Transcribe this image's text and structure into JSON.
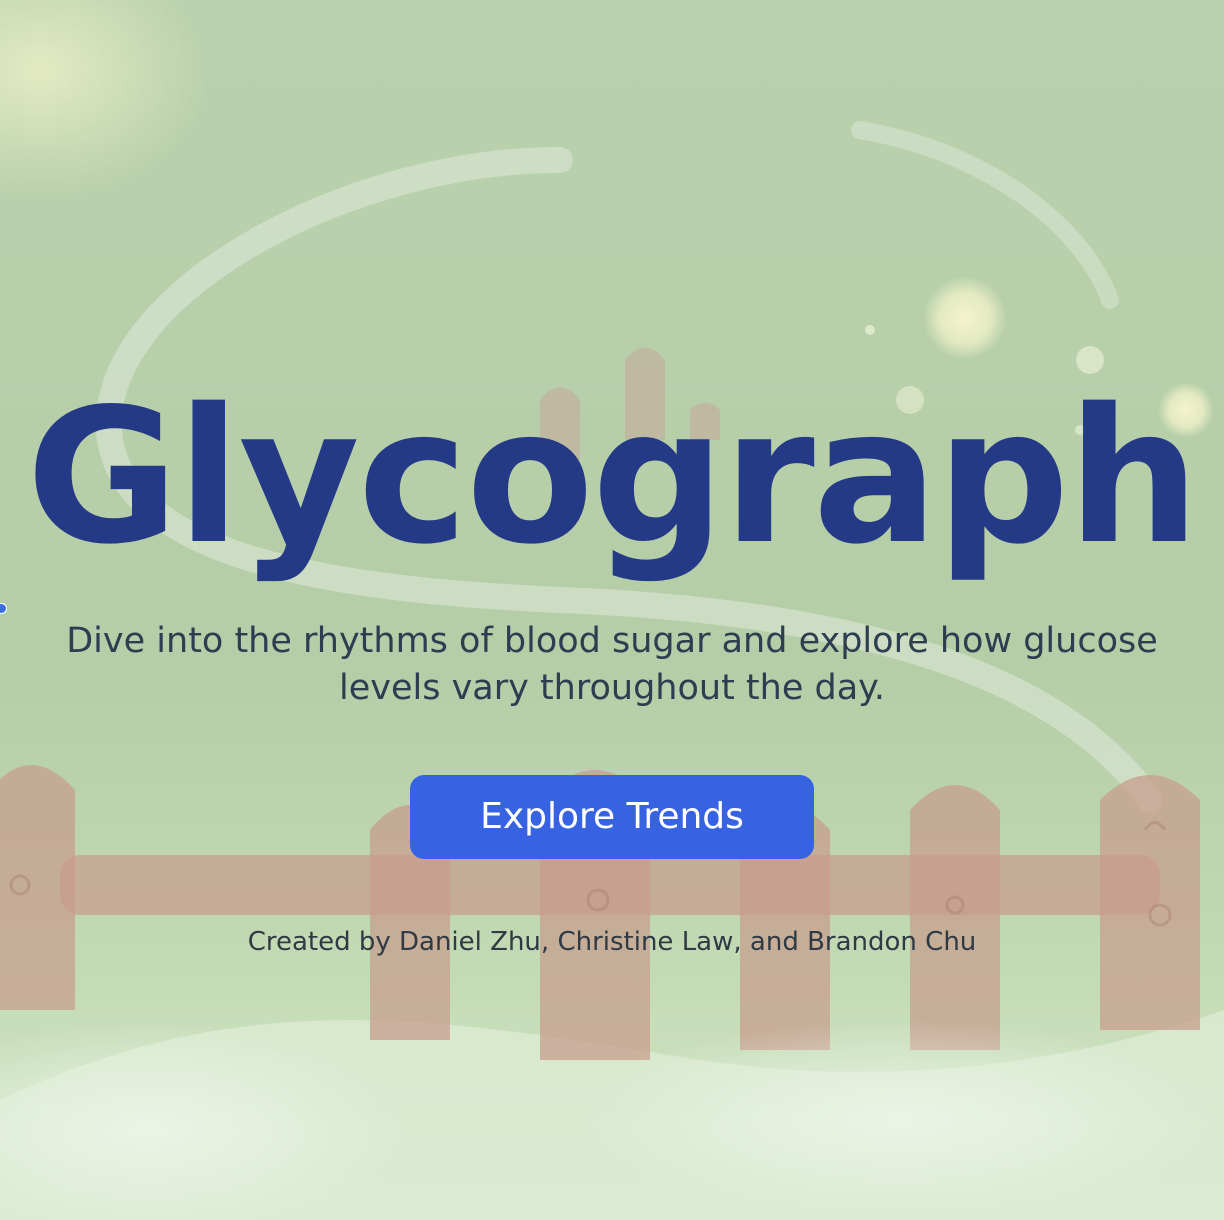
{
  "hero": {
    "title": "Glycograph",
    "subtitle": "Dive into the rhythms of blood sugar and explore how glucose levels vary throughout the day.",
    "cta_label": "Explore Trends",
    "credits": "Created by Daniel Zhu, Christine Law, and Brandon Chu"
  },
  "colors": {
    "title": "#243a87",
    "subtitle": "#2c3e50",
    "button": "#3763e2",
    "button_text": "#ffffff",
    "background": "#b7cfa9"
  },
  "background_art": {
    "description_icons": [
      "meadow-background",
      "picket-fence",
      "winding-path",
      "sparkle-dots"
    ]
  }
}
